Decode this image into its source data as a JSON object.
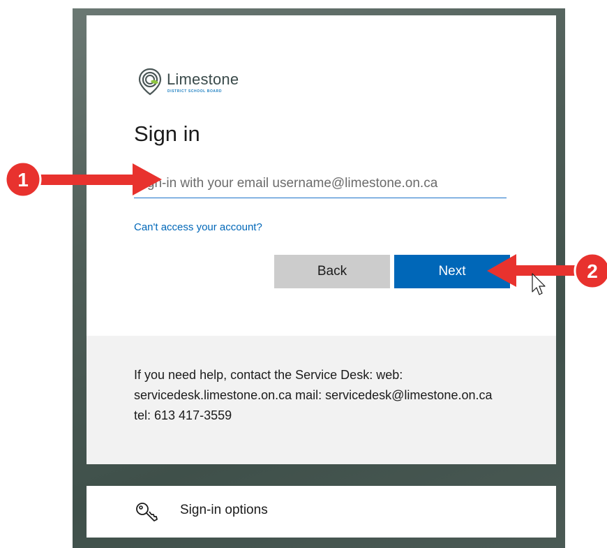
{
  "brand": {
    "name": "Limestone",
    "subtitle": "DISTRICT SCHOOL BOARD",
    "accent": "#0067b8"
  },
  "signin": {
    "title": "Sign in",
    "email_placeholder": "Sign-in with your email username@limestone.on.ca",
    "cant_access_link": "Can't access your account?",
    "back_label": "Back",
    "next_label": "Next"
  },
  "help": {
    "text": "If you need help, contact the Service Desk: web: servicedesk.limestone.on.ca mail: servicedesk@limestone.on.ca tel: 613 417-3559"
  },
  "options": {
    "icon": "key-icon",
    "label": "Sign-in options"
  },
  "annotations": {
    "step1": "1",
    "step2": "2",
    "color": "#e8322e"
  }
}
